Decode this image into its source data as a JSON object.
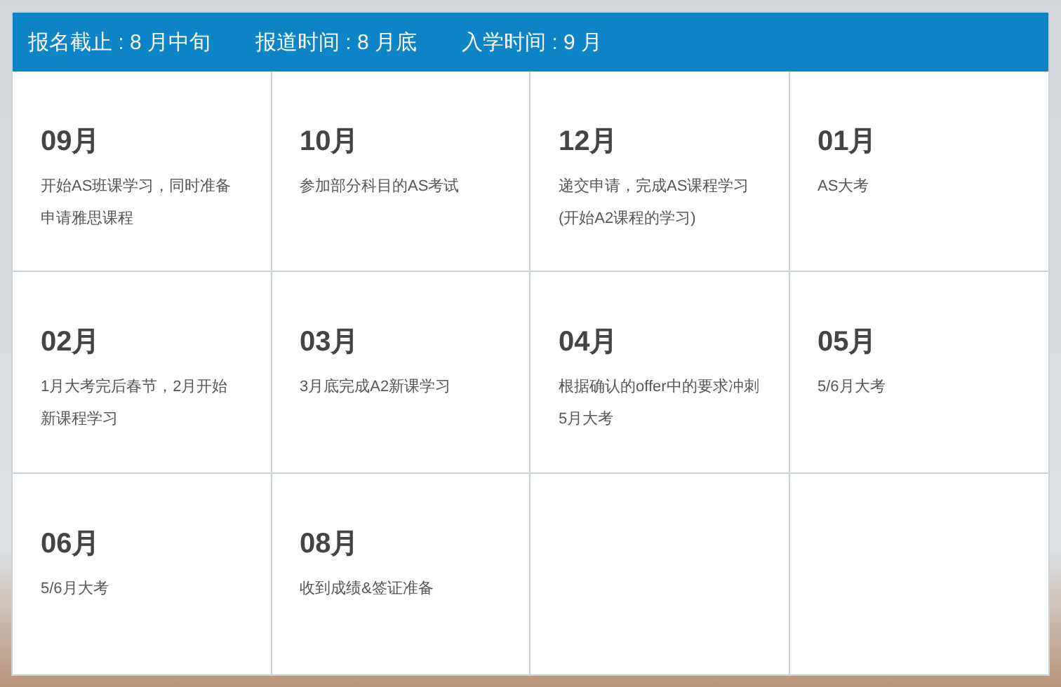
{
  "header": {
    "items": [
      "报名截止 : 8 月中旬",
      "报道时间 : 8 月底",
      "入学时间 : 9 月"
    ]
  },
  "timeline": [
    {
      "month": "09月",
      "description": "开始AS班课学习，同时准备申请雅思课程"
    },
    {
      "month": "10月",
      "description": "参加部分科目的AS考试"
    },
    {
      "month": "12月",
      "description": "递交申请，完成AS课程学习(开始A2课程的学习)"
    },
    {
      "month": "01月",
      "description": "AS大考"
    },
    {
      "month": "02月",
      "description": "1月大考完后春节，2月开始新课程学习"
    },
    {
      "month": "03月",
      "description": "3月底完成A2新课学习"
    },
    {
      "month": "04月",
      "description": "根据确认的offer中的要求冲刺5月大考"
    },
    {
      "month": "05月",
      "description": "5/6月大考"
    },
    {
      "month": "06月",
      "description": "5/6月大考"
    },
    {
      "month": "08月",
      "description": "收到成绩&签证准备"
    }
  ]
}
